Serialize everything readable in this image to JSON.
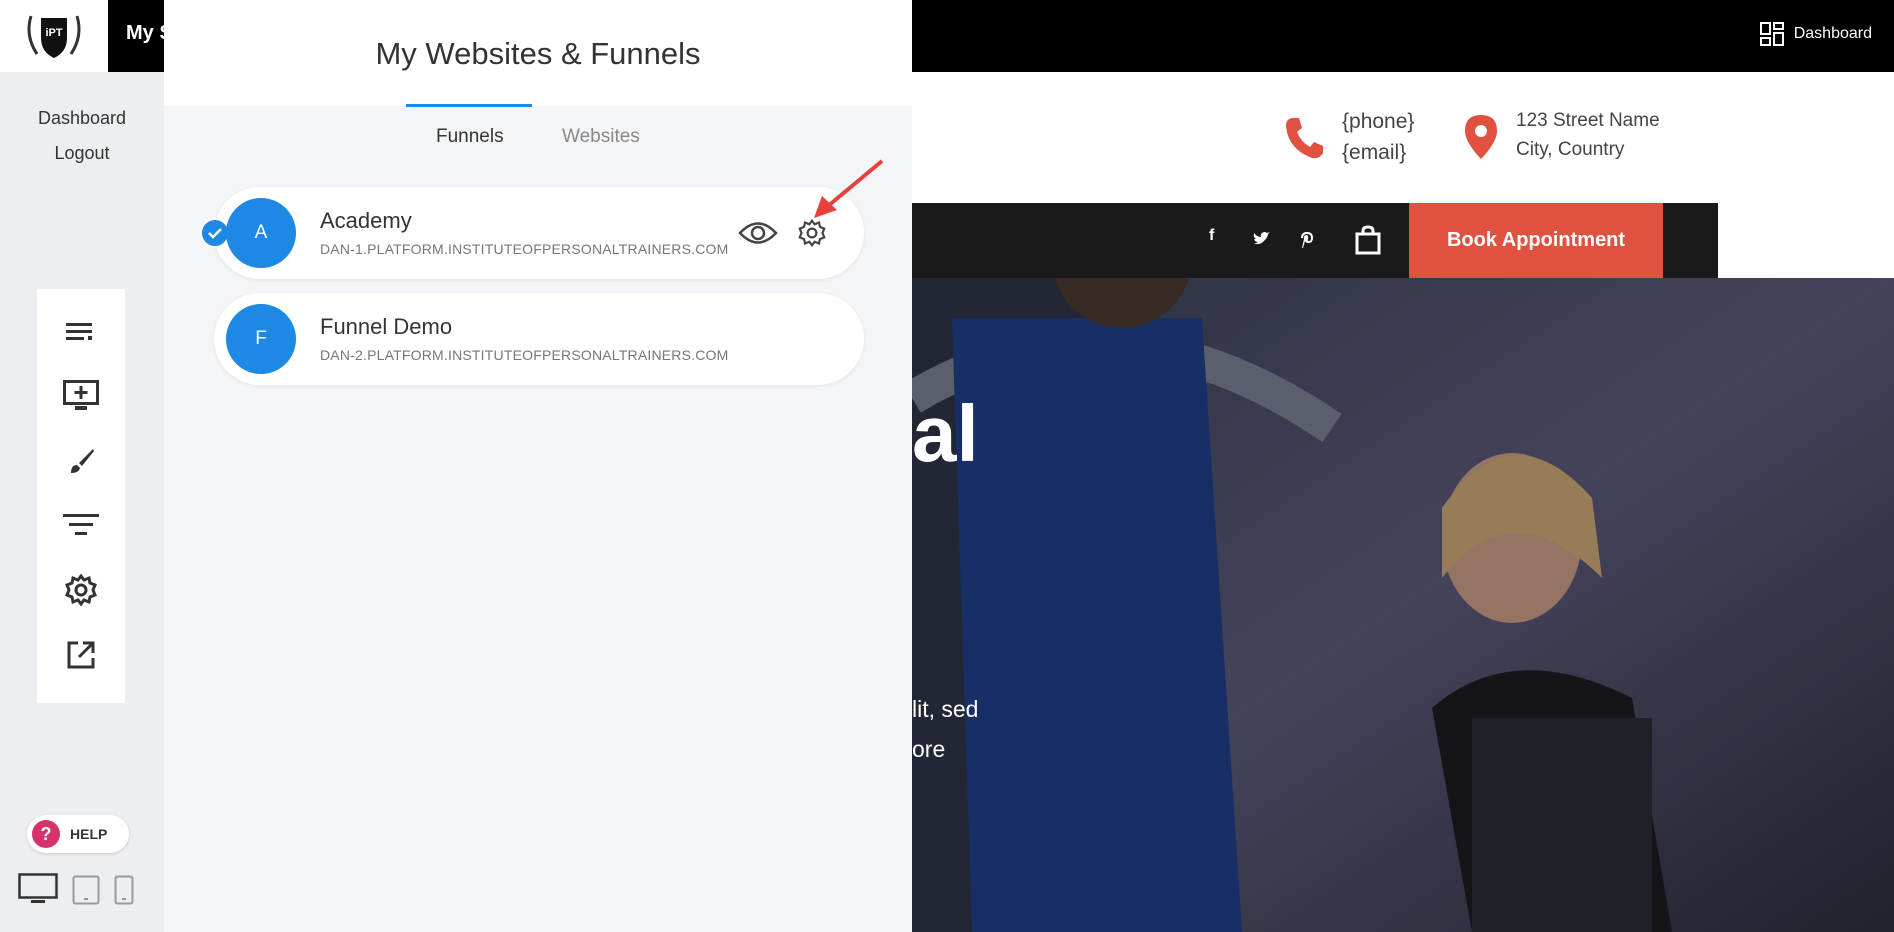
{
  "topbar": {
    "logo_text": "iPT",
    "site_title": "My S",
    "dashboard_label": "Dashboard"
  },
  "sidebar": {
    "links": [
      "Dashboard",
      "Logout"
    ],
    "tools": [
      "list-icon",
      "add-section-icon",
      "brush-icon",
      "filter-icon",
      "settings-icon",
      "external-link-icon"
    ],
    "help_label": "HELP",
    "devices": [
      "desktop-icon",
      "tablet-icon",
      "mobile-icon"
    ]
  },
  "modal": {
    "title": "My Websites & Funnels",
    "tabs": [
      {
        "label": "Funnels",
        "active": true
      },
      {
        "label": "Websites",
        "active": false
      }
    ],
    "items": [
      {
        "initial": "A",
        "name": "Academy",
        "url": "DAN-1.PLATFORM.INSTITUTEOFPERSONALTRAINERS.COM",
        "selected": true
      },
      {
        "initial": "F",
        "name": "Funnel Demo",
        "url": "DAN-2.PLATFORM.INSTITUTEOFPERSONALTRAINERS.COM",
        "selected": false
      }
    ]
  },
  "preview": {
    "phone": "{phone}",
    "email": "{email}",
    "address_line1": "123 Street Name",
    "address_line2": "City, Country",
    "book_label": "Book Appointment",
    "social": [
      "f",
      "t",
      "p"
    ],
    "hero_fragment_1": "al",
    "hero_fragment_2": "lit, sed",
    "hero_fragment_3": "ore"
  },
  "colors": {
    "accent_blue": "#1e88e5",
    "brand_red": "#e0513f",
    "help_pink": "#d6336c"
  }
}
